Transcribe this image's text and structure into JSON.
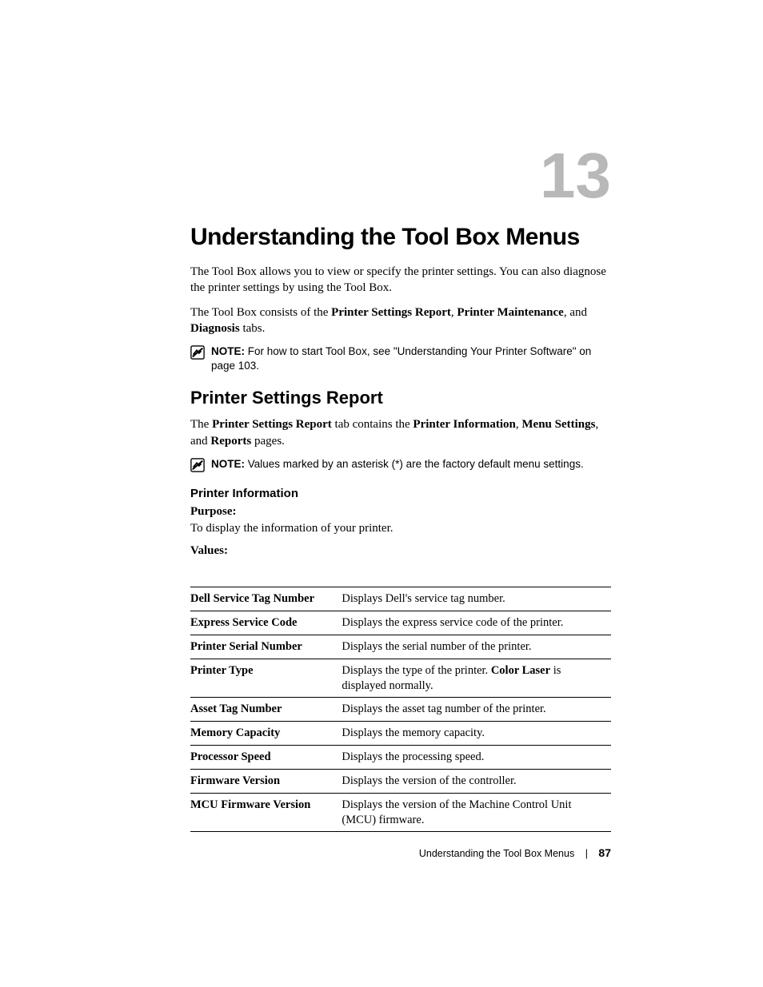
{
  "chapter_number": "13",
  "chapter_title": "Understanding the Tool Box Menus",
  "intro_1": "The Tool Box allows you to view or specify the printer settings. You can also diagnose the printer settings by using the Tool Box.",
  "intro_2_pre": "The Tool Box consists of the ",
  "intro_2_b1": "Printer Settings Report",
  "intro_2_mid1": ", ",
  "intro_2_b2": "Printer Maintenance",
  "intro_2_mid2": ", and ",
  "intro_2_b3": "Diagnosis",
  "intro_2_post": " tabs.",
  "note1_lead": "NOTE:",
  "note1_text": " For how to start Tool Box, see \"Understanding Your Printer Software\" on page 103.",
  "section_heading": "Printer Settings Report",
  "section_p_pre": "The ",
  "section_p_b1": "Printer Settings Report",
  "section_p_mid1": " tab contains the ",
  "section_p_b2": "Printer Information",
  "section_p_mid2": ", ",
  "section_p_b3": "Menu Settings",
  "section_p_mid3": ", and ",
  "section_p_b4": "Reports",
  "section_p_post": " pages.",
  "note2_lead": "NOTE:",
  "note2_text": " Values marked by an asterisk (*) are the factory default menu settings.",
  "subsection_heading": "Printer Information",
  "purpose_label": "Purpose:",
  "purpose_text": "To display the information of your printer.",
  "values_label": "Values:",
  "rows": [
    {
      "k": "Dell Service Tag Number",
      "v_pre": "Displays Dell's service tag number.",
      "v_b": "",
      "v_post": ""
    },
    {
      "k": "Express Service Code",
      "v_pre": "Displays the express service code of the printer.",
      "v_b": "",
      "v_post": ""
    },
    {
      "k": "Printer Serial Number",
      "v_pre": "Displays the serial number of the printer.",
      "v_b": "",
      "v_post": ""
    },
    {
      "k": "Printer Type",
      "v_pre": "Displays the type of the printer. ",
      "v_b": "Color Laser",
      "v_post": " is displayed normally."
    },
    {
      "k": "Asset Tag Number",
      "v_pre": "Displays the asset tag number of the printer.",
      "v_b": "",
      "v_post": ""
    },
    {
      "k": "Memory Capacity",
      "v_pre": "Displays the memory capacity.",
      "v_b": "",
      "v_post": ""
    },
    {
      "k": "Processor Speed",
      "v_pre": "Displays the processing speed.",
      "v_b": "",
      "v_post": ""
    },
    {
      "k": "Firmware Version",
      "v_pre": "Displays the version of the controller.",
      "v_b": "",
      "v_post": ""
    },
    {
      "k": "MCU Firmware Version",
      "v_pre": "Displays the version of the Machine Control Unit (MCU) firmware.",
      "v_b": "",
      "v_post": ""
    }
  ],
  "footer_title": "Understanding the Tool Box Menus",
  "footer_page": "87"
}
